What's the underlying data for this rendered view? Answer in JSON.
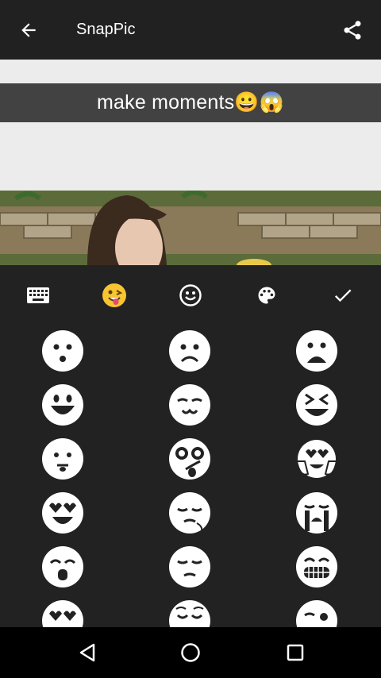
{
  "app": {
    "title": "SnapPic"
  },
  "caption": {
    "text": "make moments😀😱"
  },
  "toolbar": {
    "items": [
      "keyboard-icon",
      "emoji-tab-icon",
      "smiley-icon",
      "palette-icon",
      "check-icon"
    ]
  },
  "emoji_grid": {
    "rows": 6,
    "cols": 3,
    "items": [
      "surprised-face",
      "frowning-face",
      "anguished-face",
      "grinning-face",
      "smirk-face",
      "squinting-face",
      "neutral-face",
      "silly-face",
      "heart-eyes-hands-face",
      "heart-eyes-face",
      "sleepy-face",
      "crying-face",
      "open-mouth-face",
      "pensive-face",
      "grimacing-face",
      "kiss-face",
      "relieved-face",
      "winking-face"
    ]
  },
  "colors": {
    "appbar": "#212121",
    "background": "#222222",
    "canvas": "#ececec",
    "caption_bar": "#424242",
    "navbar": "#000000"
  }
}
